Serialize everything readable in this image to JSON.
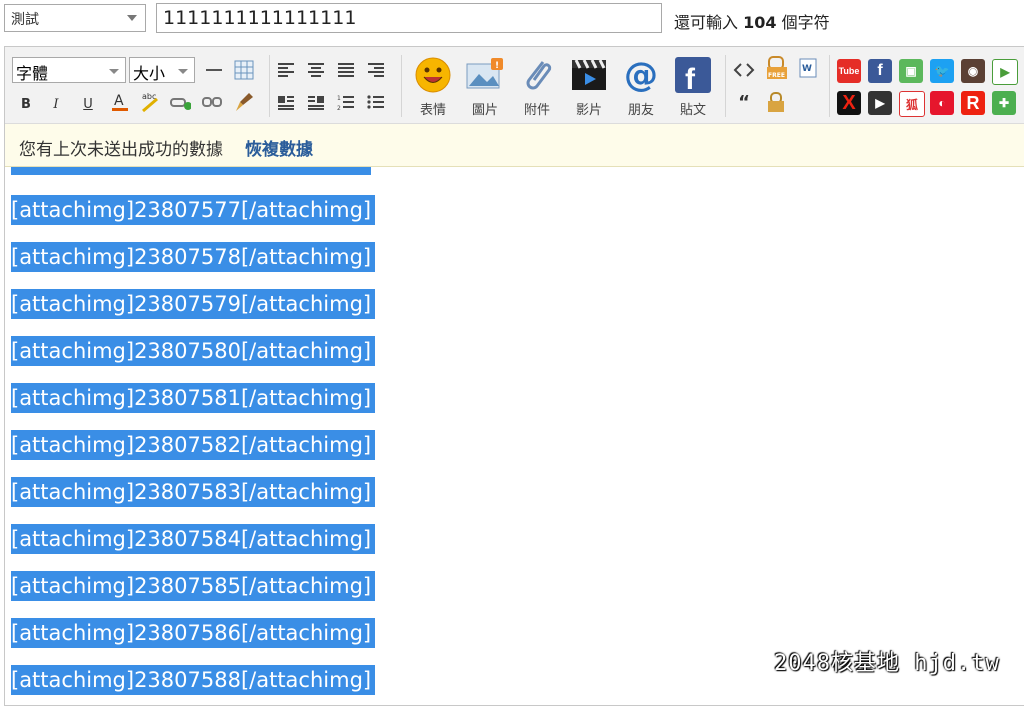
{
  "header": {
    "category_value": "測試",
    "subject_value": "1111111111111111",
    "remaining_prefix": "還可輸入",
    "remaining_count": "104",
    "remaining_suffix": "個字符"
  },
  "toolbar": {
    "font_label": "字體",
    "size_label": "大小",
    "buttons": {
      "emoji": "表情",
      "image": "圖片",
      "attachment": "附件",
      "video": "影片",
      "friends": "朋友",
      "post": "貼文"
    }
  },
  "notice": {
    "message": "您有上次未送出成功的數據",
    "restore_link": "恢複數據"
  },
  "content": {
    "lines": [
      "[attachimg]23807577[/attachimg]",
      "[attachimg]23807578[/attachimg]",
      "[attachimg]23807579[/attachimg]",
      "[attachimg]23807580[/attachimg]",
      "[attachimg]23807581[/attachimg]",
      "[attachimg]23807582[/attachimg]",
      "[attachimg]23807583[/attachimg]",
      "[attachimg]23807584[/attachimg]",
      "[attachimg]23807585[/attachimg]",
      "[attachimg]23807586[/attachimg]",
      "[attachimg]23807588[/attachimg]"
    ]
  },
  "watermark": "2048核基地 hjd.tw",
  "colors": {
    "selection": "#3a8ee6",
    "notice_bg": "#fefcea",
    "link": "#2a5c9a"
  }
}
